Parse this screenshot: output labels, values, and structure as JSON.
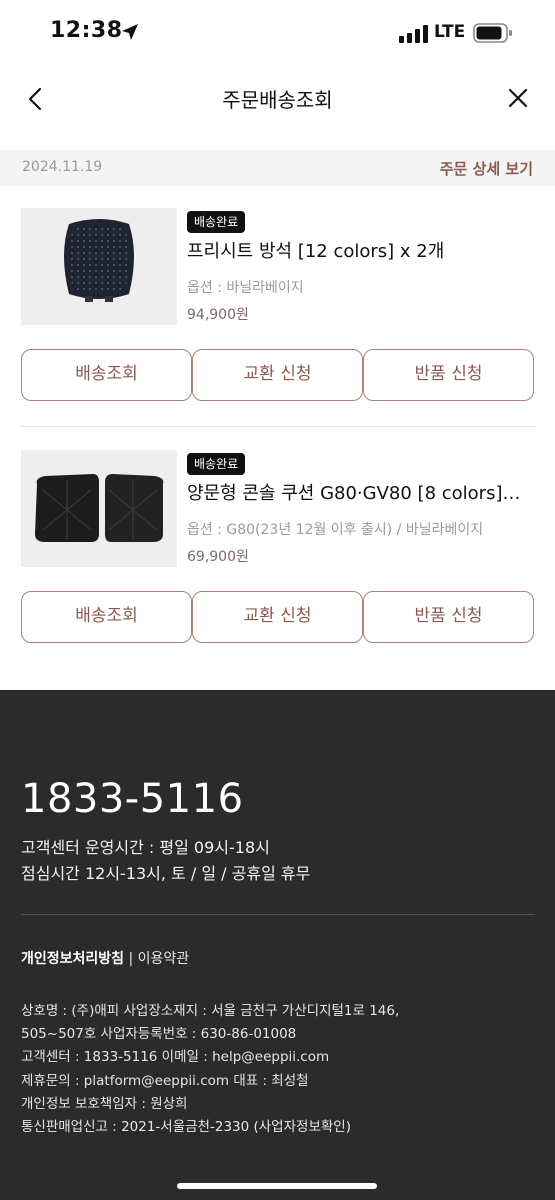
{
  "status": {
    "time": "12:38",
    "network": "LTE"
  },
  "nav": {
    "title": "주문배송조회",
    "back_icon": "chevron-left-icon",
    "close_icon": "close-icon"
  },
  "order": {
    "date": "2024.11.19",
    "detail_link": "주문 상세 보기"
  },
  "items": [
    {
      "status": "배송완료",
      "name": "프리시트 방석 [12 colors] x 2개",
      "option": "옵션 : 바닐라베이지",
      "price": "94,900원",
      "buttons": [
        "배송조회",
        "교환 신청",
        "반품 신청"
      ]
    },
    {
      "status": "배송완료",
      "name": "양문형 콘솔 쿠션 G80·GV80 [8 colors]…",
      "option": "옵션 : G80(23년 12월 이후 출시) / 바닐라베이지",
      "price": "69,900원",
      "buttons": [
        "배송조회",
        "교환 신청",
        "반품 신청"
      ]
    }
  ],
  "footer": {
    "phone": "1833-5116",
    "hours": "고객센터 운영시간 : 평일 09시-18시",
    "lunch": "점심시간 12시-13시, 토 / 일 / 공휴일 휴무",
    "privacy_link": "개인정보처리방침",
    "separator": "|",
    "terms_link": "이용약관",
    "company_lines": [
      "상호명 : (주)애피 사업장소재지 : 서울 금천구 가산디지털1로 146,",
      "505~507호 사업자등록번호 : 630-86-01008",
      "고객센터 : 1833-5116 이메일 : help@eeppii.com",
      "제휴문의 : platform@eeppii.com 대표 : 최성철",
      "개인정보 보호책임자 : 원상희",
      "통신판매업신고 : 2021-서울금천-2330 (사업자정보확인)"
    ]
  },
  "colors": {
    "accent": "#8a5a52",
    "button_border": "#b0817a",
    "footer_bg": "#2b2b2b"
  }
}
